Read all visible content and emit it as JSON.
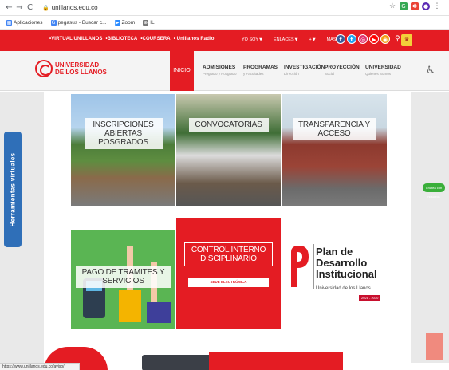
{
  "browser": {
    "url": "unillanos.edu.co",
    "bookmarks": [
      {
        "label": "Aplicaciones",
        "icon": "apps-grid-icon",
        "color": "#4285f4"
      },
      {
        "label": "pegasus - Buscar c...",
        "icon": "google-g-icon",
        "color": "#4285f4"
      },
      {
        "label": "Zoom",
        "icon": "zoom-icon",
        "color": "#2d8cff"
      },
      {
        "label": "IL",
        "icon": "site-icon",
        "color": "#777777"
      }
    ],
    "status_url": "https://www.unillanos.edu.co/aviso/"
  },
  "topbar": {
    "quick_links": [
      "•VIRTUAL UNILLANOS",
      "•BIBLIOTECA",
      "•COURSERA",
      "• Unillanos Radio"
    ],
    "menus": [
      {
        "label": "YO SOY"
      },
      {
        "label": "ENLACES"
      },
      {
        "label": "+"
      },
      {
        "label": "MÁS"
      }
    ],
    "socials": [
      {
        "glyph": "f",
        "color": "#3b5998",
        "icon": "facebook-icon"
      },
      {
        "glyph": "t",
        "color": "#1da1f2",
        "icon": "twitter-icon"
      },
      {
        "glyph": "◎",
        "color": "#e1306c",
        "icon": "instagram-icon"
      },
      {
        "glyph": "▶",
        "color": "#ff0000",
        "icon": "youtube-icon"
      },
      {
        "glyph": "◉",
        "color": "#f39c12",
        "icon": "rss-icon"
      }
    ]
  },
  "header": {
    "logo_line1": "UNIVERSIDAD",
    "logo_line2": "DE LOS LLANOS",
    "inicio": "INICIO",
    "nav": [
      {
        "title": "ADMISIONES",
        "sub": "Pregrado y Posgrado"
      },
      {
        "title": "PROGRAMAS",
        "sub": "y Facultades"
      },
      {
        "title": "INVESTIGACIÓN",
        "sub": "Dirección"
      },
      {
        "title": "PROYECCIÓN",
        "sub": "Social"
      },
      {
        "title": "UNIVERSIDAD",
        "sub": "Quiénes Somos"
      }
    ]
  },
  "sidebar": {
    "tab_label": "Herramientas virtuales"
  },
  "whatsapp": {
    "label": "Chatea con nosotros"
  },
  "tiles": {
    "inscripciones": "INSCRIPCIONES ABIERTAS POSGRADOS",
    "convocatorias": "CONVOCATORIAS",
    "transparencia": "TRANSPARENCIA Y ACCESO",
    "pago": "PAGO DE TRAMITES Y SERVICIOS",
    "control": "CONTROL INTERNO DISCIPLINARIO",
    "sede": "SEDE ELECTRÓNICA",
    "plan_title": "Plan de Desarrollo Institucional",
    "plan_sub": "Universidad de los Llanos",
    "plan_years": "2021 - 2030"
  }
}
